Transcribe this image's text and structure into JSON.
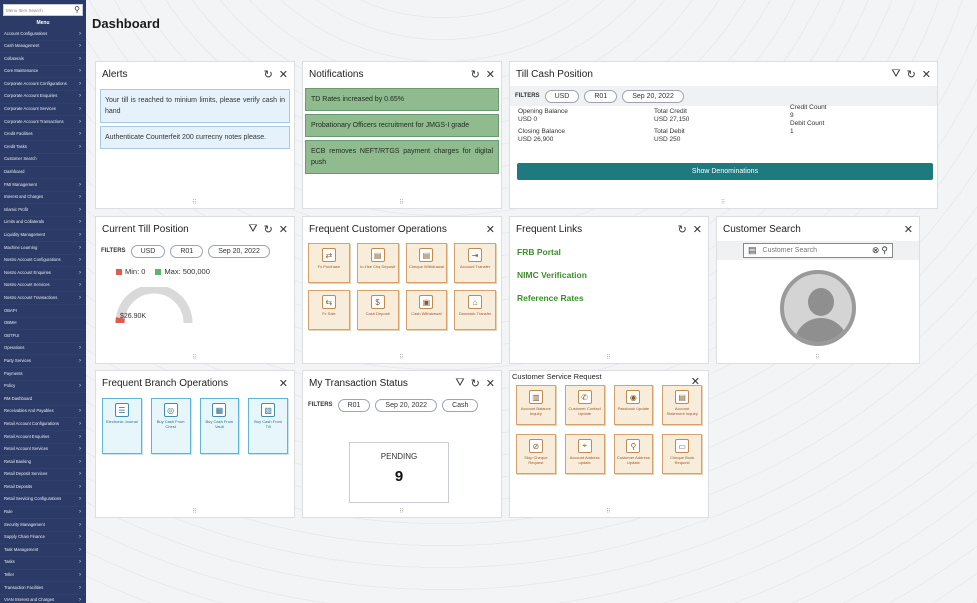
{
  "sidebar": {
    "search_placeholder": "Menu Item Search",
    "menu_title": "Menu",
    "items": [
      {
        "label": "Account Configurations",
        "arrow": true
      },
      {
        "label": "Cash Management",
        "arrow": true
      },
      {
        "label": "Collaterals",
        "arrow": true
      },
      {
        "label": "Core Maintenance",
        "arrow": true
      },
      {
        "label": "Corporate Account Configurations",
        "arrow": true
      },
      {
        "label": "Corporate Account Enquiries",
        "arrow": true
      },
      {
        "label": "Corporate Account Services",
        "arrow": true
      },
      {
        "label": "Corporate Account Transactions",
        "arrow": true
      },
      {
        "label": "Credit Facilities",
        "arrow": true
      },
      {
        "label": "Credit Tasks",
        "arrow": true
      },
      {
        "label": "Customer Search",
        "arrow": false
      },
      {
        "label": "Dashboard",
        "arrow": false
      },
      {
        "label": "FMI Management",
        "arrow": true
      },
      {
        "label": "Interest and Charges",
        "arrow": true
      },
      {
        "label": "Islamic Profit",
        "arrow": true
      },
      {
        "label": "Limits and Collaterals",
        "arrow": true
      },
      {
        "label": "Liquidity Management",
        "arrow": true
      },
      {
        "label": "Machine Learning",
        "arrow": true
      },
      {
        "label": "Nostro Account Configurations",
        "arrow": true
      },
      {
        "label": "Nostro Account Enquiries",
        "arrow": true
      },
      {
        "label": "Nostro Account Services",
        "arrow": true
      },
      {
        "label": "Nostro Account Transactions",
        "arrow": true
      },
      {
        "label": "OBAPI",
        "arrow": false
      },
      {
        "label": "OBMH",
        "arrow": false
      },
      {
        "label": "OBTFUI",
        "arrow": false
      },
      {
        "label": "Operations",
        "arrow": true
      },
      {
        "label": "Party Services",
        "arrow": true
      },
      {
        "label": "Payments",
        "arrow": false
      },
      {
        "label": "Policy",
        "arrow": true
      },
      {
        "label": "RM Dashboard",
        "arrow": false
      },
      {
        "label": "Receivables And Payables",
        "arrow": true
      },
      {
        "label": "Retail Account Configurations",
        "arrow": true
      },
      {
        "label": "Retail Account Enquiries",
        "arrow": true
      },
      {
        "label": "Retail Account Services",
        "arrow": true
      },
      {
        "label": "Retail Banking",
        "arrow": true
      },
      {
        "label": "Retail Deposit Services",
        "arrow": true
      },
      {
        "label": "Retail Deposits",
        "arrow": true
      },
      {
        "label": "Retail Servicing Configurations",
        "arrow": true
      },
      {
        "label": "Rule",
        "arrow": true
      },
      {
        "label": "Security Management",
        "arrow": true
      },
      {
        "label": "Supply Chain Finance",
        "arrow": true
      },
      {
        "label": "Task Management",
        "arrow": true
      },
      {
        "label": "Tasks",
        "arrow": true
      },
      {
        "label": "Teller",
        "arrow": true
      },
      {
        "label": "Transaction Facilities",
        "arrow": true
      },
      {
        "label": "VIAN Interest and Charges",
        "arrow": true
      }
    ]
  },
  "page": {
    "title": "Dashboard"
  },
  "alerts": {
    "title": "Alerts",
    "messages": [
      "Your till is reached to minium limits, please verify cash in hand",
      "Authenticate Counterfeit 200 currecny notes please."
    ]
  },
  "notifications": {
    "title": "Notifications",
    "messages": [
      "TD Rates increased by 0.65%",
      "Probationary Officers recruitment for JMGS-I grade",
      "ECB removes NEFT/RTGS payment charges for digital push"
    ]
  },
  "till_cash": {
    "title": "Till Cash Position",
    "filters_label": "FILTERS",
    "chips": [
      "USD",
      "R01",
      "Sep 20, 2022"
    ],
    "opening_balance_label": "Opening Balance",
    "opening_balance": "USD 0",
    "closing_balance_label": "Closing Balance",
    "closing_balance": "USD 26,900",
    "total_credit_label": "Total Credit",
    "total_credit": "USD 27,150",
    "total_debit_label": "Total Debit",
    "total_debit": "USD 250",
    "credit_count_label": "Credit Count",
    "credit_count": "9",
    "debit_count_label": "Debit Count",
    "debit_count": "1",
    "button": "Show Denominations"
  },
  "current_till": {
    "title": "Current Till Position",
    "filters_label": "FILTERS",
    "chips": [
      "USD",
      "R01",
      "Sep 20, 2022"
    ],
    "min_label": "Min: 0",
    "max_label": "Max: 500,000",
    "gauge_value": "$26.90K",
    "colors": {
      "min": "#e05a4f",
      "max": "#5bb46e"
    }
  },
  "customer_ops": {
    "title": "Frequent Customer Operations",
    "tiles": [
      {
        "label": "Fx Purchase",
        "icon": "exchange-icon",
        "glyph": "⇄"
      },
      {
        "label": "In-Hse Chq Deposit",
        "icon": "cheque-icon",
        "glyph": "▤"
      },
      {
        "label": "Cheque Withdrawal",
        "icon": "cheque-out-icon",
        "glyph": "▤"
      },
      {
        "label": "Account Transfer",
        "icon": "transfer-icon",
        "glyph": "⇥"
      },
      {
        "label": "Fx Sale",
        "icon": "exchange-icon",
        "glyph": "⇆"
      },
      {
        "label": "Cash Deposit",
        "icon": "cash-in-icon",
        "glyph": "$"
      },
      {
        "label": "Cash Withdrawal",
        "icon": "cash-out-icon",
        "glyph": "▣"
      },
      {
        "label": "Domestic Transfer",
        "icon": "bank-icon",
        "glyph": "⌂"
      }
    ]
  },
  "frequent_links": {
    "title": "Frequent Links",
    "links": [
      "FRB Portal",
      "NIMC Verification",
      "Reference Rates"
    ]
  },
  "customer_search": {
    "title": "Customer Search",
    "placeholder": "Customer Search"
  },
  "branch_ops": {
    "title": "Frequent Branch Operations",
    "tiles": [
      {
        "label": "Electronic Journal",
        "icon": "journal-icon",
        "glyph": "☰"
      },
      {
        "label": "Buy Cash From Chest",
        "icon": "cash-chest-icon",
        "glyph": "◎"
      },
      {
        "label": "Buy Cash From Vault",
        "icon": "vault-icon",
        "glyph": "▦"
      },
      {
        "label": "Buy Cash From Till",
        "icon": "till-icon",
        "glyph": "▧"
      }
    ]
  },
  "txn_status": {
    "title": "My Transaction Status",
    "filters_label": "FILTERS",
    "chips": [
      "R01",
      "Sep 20, 2022",
      "Cash"
    ],
    "status_label": "PENDING",
    "status_count": "9"
  },
  "service_request": {
    "title": "Customer Service Request",
    "tiles": [
      {
        "label": "Account Balance Inquiry",
        "icon": "balance-icon",
        "glyph": "▥"
      },
      {
        "label": "Customer Contact Update",
        "icon": "phone-icon",
        "glyph": "✆"
      },
      {
        "label": "Passbook Update",
        "icon": "passbook-icon",
        "glyph": "◉"
      },
      {
        "label": "Account Statement Inquiry",
        "icon": "statement-icon",
        "glyph": "▤"
      },
      {
        "label": "Stop Cheque Request",
        "icon": "stop-cheque-icon",
        "glyph": "⊘"
      },
      {
        "label": "Account Address update",
        "icon": "address-icon",
        "glyph": "⌖"
      },
      {
        "label": "Customer Address Update",
        "icon": "location-icon",
        "glyph": "⚲"
      },
      {
        "label": "Cheque Book Request",
        "icon": "cheque-book-icon",
        "glyph": "▭"
      }
    ]
  },
  "icons": {
    "refresh": "↻",
    "close": "✕",
    "filter": "⛛",
    "search": "⚲",
    "clear": "⊗",
    "arrow": "›",
    "grip": "⠿"
  }
}
